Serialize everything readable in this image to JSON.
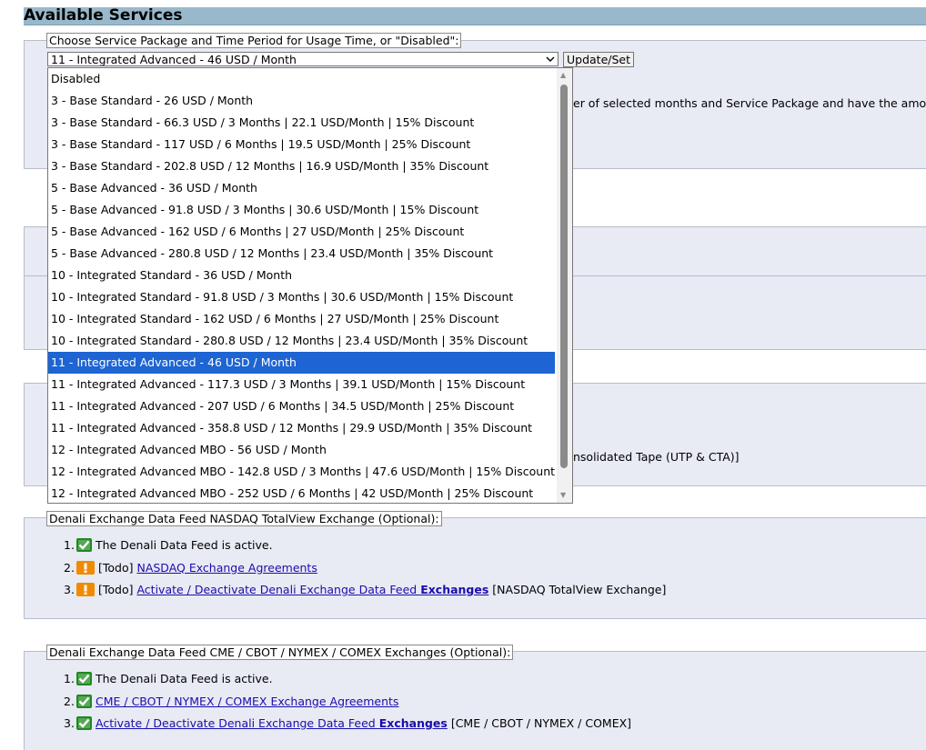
{
  "page": {
    "title": "Available Services"
  },
  "service_package": {
    "legend": "Choose Service Package and Time Period for Usage Time, or \"Disabled\":",
    "selected_value": "11 - Integrated Advanced - 46 USD / Month",
    "update_button": "Update/Set",
    "options": [
      "Disabled",
      "3 - Base Standard - 26 USD / Month",
      "3 - Base Standard - 66.3 USD / 3 Months | 22.1 USD/Month | 15% Discount",
      "3 - Base Standard - 117 USD / 6 Months | 19.5 USD/Month | 25% Discount",
      "3 - Base Standard - 202.8 USD / 12 Months | 16.9 USD/Month | 35% Discount",
      "5 - Base Advanced - 36 USD / Month",
      "5 - Base Advanced - 91.8 USD / 3 Months | 30.6 USD/Month | 15% Discount",
      "5 - Base Advanced - 162 USD / 6 Months | 27 USD/Month | 25% Discount",
      "5 - Base Advanced - 280.8 USD / 12 Months | 23.4 USD/Month | 35% Discount",
      "10 - Integrated Standard - 36 USD / Month",
      "10 - Integrated Standard - 91.8 USD / 3 Months | 30.6 USD/Month | 15% Discount",
      "10 - Integrated Standard - 162 USD / 6 Months | 27 USD/Month | 25% Discount",
      "10 - Integrated Standard - 280.8 USD / 12 Months | 23.4 USD/Month | 35% Discount",
      "11 - Integrated Advanced - 46 USD / Month",
      "11 - Integrated Advanced - 117.3 USD / 3 Months | 39.1 USD/Month | 15% Discount",
      "11 - Integrated Advanced - 207 USD / 6 Months | 34.5 USD/Month | 25% Discount",
      "11 - Integrated Advanced - 358.8 USD / 12 Months | 29.9 USD/Month | 35% Discount",
      "12 - Integrated Advanced MBO - 56 USD / Month",
      "12 - Integrated Advanced MBO - 142.8 USD / 3 Months | 47.6 USD/Month | 15% Discount",
      "12 - Integrated Advanced MBO - 252 USD / 6 Months | 42 USD/Month | 25% Discount"
    ],
    "selected_index": 13,
    "hidden_text_fragment": "er of selected months and Service Package and have the amount d"
  },
  "obscured_fragment": "nsolidated Tape (UTP & CTA)]",
  "nasdaq_feed": {
    "legend": "Denali Exchange Data Feed NASDAQ TotalView Exchange (Optional):",
    "items": [
      {
        "num": "1.",
        "status": "ok",
        "text": "The Denali Data Feed is active."
      },
      {
        "num": "2.",
        "status": "todo",
        "prefix": "[Todo]",
        "link": "NASDAQ Exchange Agreements"
      },
      {
        "num": "3.",
        "status": "todo",
        "prefix": "[Todo]",
        "link": "Activate / Deactivate Denali Exchange Data Feed ",
        "link_bold": "Exchanges",
        "suffix": " [NASDAQ TotalView Exchange]"
      }
    ]
  },
  "cme_feed": {
    "legend": "Denali Exchange Data Feed CME / CBOT / NYMEX / COMEX Exchanges (Optional):",
    "items": [
      {
        "num": "1.",
        "status": "ok",
        "text": "The Denali Data Feed is active."
      },
      {
        "num": "2.",
        "status": "ok",
        "link": "CME / CBOT / NYMEX / COMEX Exchange Agreements"
      },
      {
        "num": "3.",
        "status": "ok",
        "link": "Activate / Deactivate Denali Exchange Data Feed ",
        "link_bold": "Exchanges",
        "suffix": " [CME / CBOT / NYMEX / COMEX]"
      }
    ]
  },
  "colors": {
    "header_bg": "#9ab8cc",
    "panel_bg": "#e8eaf4",
    "selected_bg": "#1e64d2",
    "ok_icon": "#1f8a1f",
    "todo_icon": "#f08a00",
    "link": "#1a0dab"
  }
}
